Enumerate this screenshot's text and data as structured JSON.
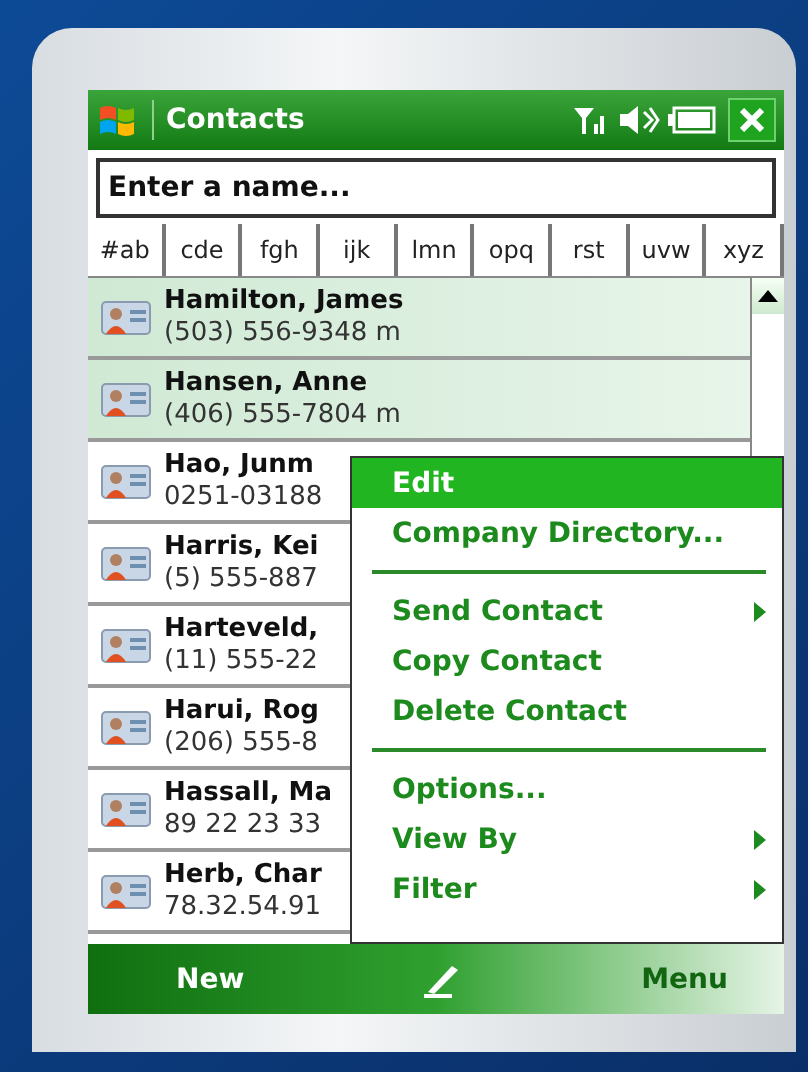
{
  "title_bar": {
    "title": "Contacts"
  },
  "search": {
    "placeholder": "Enter a name..."
  },
  "letter_tabs": [
    {
      "label": "#ab"
    },
    {
      "label": "cde"
    },
    {
      "label": "fgh"
    },
    {
      "label": "ijk"
    },
    {
      "label": "lmn"
    },
    {
      "label": "opq"
    },
    {
      "label": "rst"
    },
    {
      "label": "uvw"
    },
    {
      "label": "xyz"
    }
  ],
  "contacts": [
    {
      "name": "Hamilton, James",
      "phone": "(503) 556-9348  m",
      "selected": true
    },
    {
      "name": "Hansen, Anne",
      "phone": "(406) 555-7804  m",
      "selected": true
    },
    {
      "name": "Hao, Junm",
      "phone": "0251-03188",
      "selected": false
    },
    {
      "name": "Harris, Kei",
      "phone": "(5) 555-887",
      "selected": false
    },
    {
      "name": "Harteveld,",
      "phone": "(11) 555-22",
      "selected": false
    },
    {
      "name": "Harui, Rog",
      "phone": "(206) 555-8",
      "selected": false
    },
    {
      "name": "Hassall, Ma",
      "phone": "89 22 23 33",
      "selected": false
    },
    {
      "name": "Herb, Char",
      "phone": "78.32.54.91",
      "selected": false
    }
  ],
  "context_menu": [
    {
      "kind": "item",
      "label": "Edit",
      "selected": true,
      "submenu": false
    },
    {
      "kind": "item",
      "label": "Company Directory...",
      "selected": false,
      "submenu": false
    },
    {
      "kind": "separator"
    },
    {
      "kind": "item",
      "label": "Send Contact",
      "selected": false,
      "submenu": true
    },
    {
      "kind": "item",
      "label": "Copy Contact",
      "selected": false,
      "submenu": false
    },
    {
      "kind": "item",
      "label": "Delete Contact",
      "selected": false,
      "submenu": false
    },
    {
      "kind": "separator"
    },
    {
      "kind": "item",
      "label": "Options...",
      "selected": false,
      "submenu": false
    },
    {
      "kind": "item",
      "label": "View By",
      "selected": false,
      "submenu": true
    },
    {
      "kind": "item",
      "label": "Filter",
      "selected": false,
      "submenu": true
    }
  ],
  "soft_keys": {
    "left": "New",
    "right": "Menu"
  }
}
